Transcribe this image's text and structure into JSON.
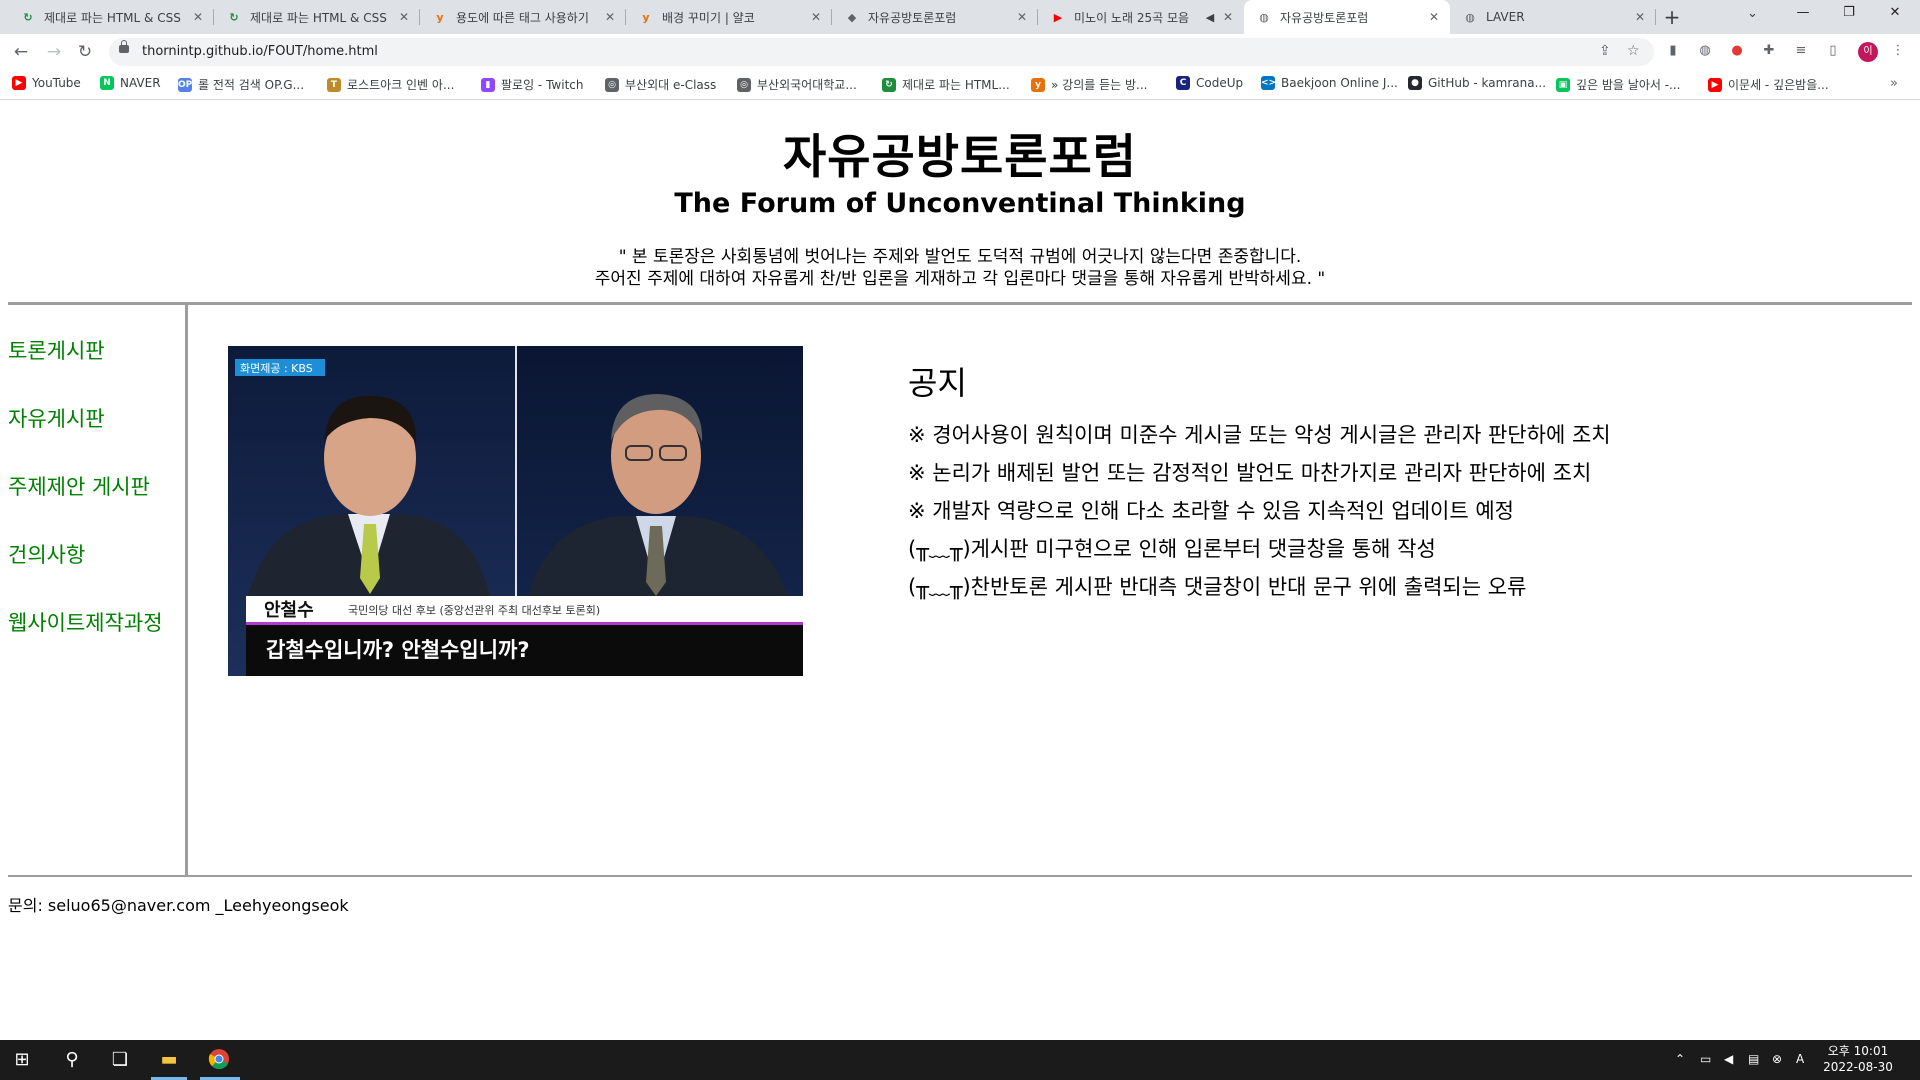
{
  "browser": {
    "tabs": [
      {
        "label": "제대로 파는 HTML & CSS",
        "icon": "refresh-icon",
        "color": "#1e8e3e"
      },
      {
        "label": "제대로 파는 HTML & CSS",
        "icon": "refresh-icon",
        "color": "#1e8e3e"
      },
      {
        "label": "용도에 따른 태그 사용하기",
        "icon": "yalco-icon",
        "color": "#e8710a"
      },
      {
        "label": "배경 꾸미기 | 얄코",
        "icon": "yalco-icon",
        "color": "#e8710a"
      },
      {
        "label": "자유공방토론포럼",
        "icon": "chat-icon",
        "color": "#5f6368"
      },
      {
        "label": "미노이 노래 25곡 모음",
        "icon": "youtube-icon",
        "color": "#ff0000"
      },
      {
        "label": "자유공방토론포럼",
        "icon": "globe-icon",
        "color": "#5f6368"
      },
      {
        "label": "LAVER",
        "icon": "globe-icon",
        "color": "#5f6368"
      }
    ],
    "active_tab_index": 6,
    "new_tab_label": "+",
    "url": "thornintp.github.io/FOUT/home.html",
    "profile_initial": "이",
    "bookmarks": [
      {
        "label": "YouTube",
        "color": "#ff0000",
        "glyph": "▶"
      },
      {
        "label": "NAVER",
        "color": "#03c75a",
        "glyph": "N"
      },
      {
        "label": "롤 전적 검색 OP.G...",
        "color": "#5383e8",
        "glyph": "OP"
      },
      {
        "label": "로스트아크 인벤 아...",
        "color": "#c08a2a",
        "glyph": "T"
      },
      {
        "label": "팔로잉 - Twitch",
        "color": "#9146ff",
        "glyph": "▮"
      },
      {
        "label": "부산외대 e-Class",
        "color": "#5f6368",
        "glyph": "◎"
      },
      {
        "label": "부산외국어대학교...",
        "color": "#5f6368",
        "glyph": "◎"
      },
      {
        "label": "제대로 파는 HTML...",
        "color": "#1e8e3e",
        "glyph": "↻"
      },
      {
        "label": "» 강의를 듣는 방...",
        "color": "#e8710a",
        "glyph": "y"
      },
      {
        "label": "CodeUp",
        "color": "#1a237e",
        "glyph": "C"
      },
      {
        "label": "Baekjoon Online J...",
        "color": "#0076c0",
        "glyph": "<>"
      },
      {
        "label": "GitHub - kamrana...",
        "color": "#24292f",
        "glyph": "●"
      },
      {
        "label": "깊은 밤을 날아서 -...",
        "color": "#03c75a",
        "glyph": "▣"
      },
      {
        "label": "이문세 - 깊은밤을...",
        "color": "#ff0000",
        "glyph": "▶"
      }
    ]
  },
  "site": {
    "title": "자유공방토론포럼",
    "subtitle": "The Forum of Unconventinal Thinking",
    "motto_line1": "\" 본 토론장은 사회통념에 벗어나는 주제와 발언도 도덕적 규범에 어긋나지 않는다면 존중합니다.",
    "motto_line2": "주어진 주제에 대하여 자유롭게 찬/반 입론을 게재하고 각 입론마다 댓글을 통해 자유롭게 반박하세요. \"",
    "nav": [
      {
        "label": "토론게시판"
      },
      {
        "label": "자유게시판"
      },
      {
        "label": "주제제안 게시판"
      },
      {
        "label": "건의사항"
      },
      {
        "label": "웹사이트제작과정"
      }
    ],
    "nav_color": "#008000",
    "image": {
      "badge": "화면제공 : KBS",
      "name": "안철수",
      "caption_small": "국민의당 대선 후보 (중앙선관위 주최 대선후보 토론회)",
      "caption_main": "갑철수입니까? 안철수입니까?"
    },
    "notice": {
      "title": "공지",
      "lines": [
        "※ 경어사용이 원칙이며 미준수 게시글 또는 악성 게시글은 관리자 판단하에 조치",
        "※ 논리가 배제된 발언 또는 감정적인 발언도 마찬가지로 관리자 판단하에 조치",
        "※ 개발자 역량으로 인해 다소 초라할 수 있음 지속적인 업데이트 예정",
        "(╥﹏╥)게시판 미구현으로 인해 입론부터 댓글창을 통해 작성",
        "(╥﹏╥)찬반토론 게시판 반대측 댓글창이 반대 문구 위에 출력되는 오류"
      ]
    },
    "contact": "문의: seluo65@naver.com _Leehyeongseok"
  },
  "taskbar": {
    "time_line1": "오후 10:01",
    "time_line2": "2022-08-30",
    "ime": "A"
  }
}
